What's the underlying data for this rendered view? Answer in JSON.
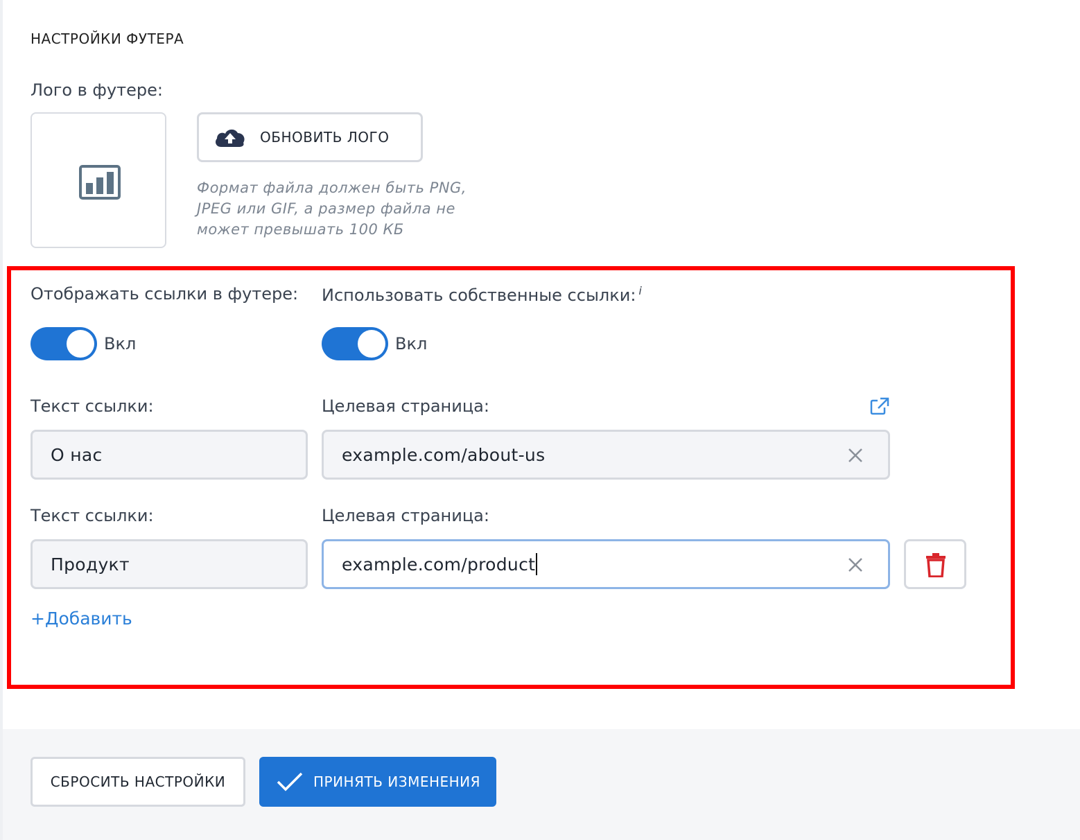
{
  "section": {
    "title": "НАСТРОЙКИ ФУТЕРА"
  },
  "logo": {
    "label": "Лого в футере:",
    "upload_button": "ОБНОВИТЬ ЛОГО",
    "hint": "Формат файла должен быть PNG, JPEG или GIF, а размер файла не может превышать 100 КБ"
  },
  "toggles": {
    "show_links": {
      "label": "Отображать ссылки в футере:",
      "state": "Вкл",
      "on": true
    },
    "custom_links": {
      "label": "Использовать собственные ссылки:",
      "info": "i",
      "state": "Вкл",
      "on": true
    }
  },
  "links": [
    {
      "text_label": "Текст ссылки:",
      "text_value": "О нас",
      "target_label": "Целевая страница:",
      "target_value": "example.com/about-us"
    },
    {
      "text_label": "Текст ссылки:",
      "text_value": "Продукт",
      "target_label": "Целевая страница:",
      "target_value": "example.com/product"
    }
  ],
  "add_link": "+Добавить",
  "footer": {
    "reset_button": "СБРОСИТЬ НАСТРОЙКИ",
    "apply_button": "ПРИНЯТЬ ИЗМЕНЕНИЯ"
  },
  "colors": {
    "accent": "#1f74d4",
    "link": "#2a7fd8",
    "danger": "#d9262c",
    "highlight_frame": "#ff0000"
  }
}
